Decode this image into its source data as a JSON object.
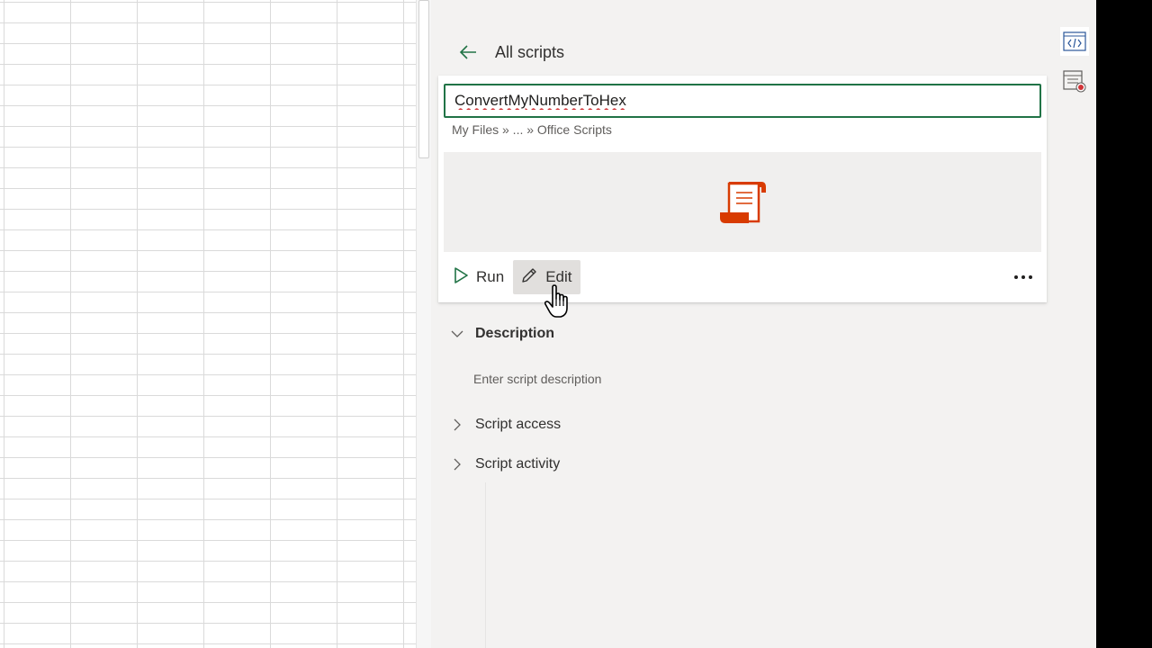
{
  "pane": {
    "back_label": "All scripts",
    "script_name": "ConvertMyNumberToHex",
    "path": "My Files » ... » Office Scripts",
    "actions": {
      "run_label": "Run",
      "edit_label": "Edit"
    },
    "sections": {
      "description_label": "Description",
      "description_placeholder": "Enter script description",
      "access_label": "Script access",
      "activity_label": "Script activity"
    }
  },
  "icons": {
    "back": "arrow-left-icon",
    "script_preview": "script-scroll-icon",
    "run": "play-icon",
    "edit": "pencil-icon",
    "more": "more-horizontal-icon",
    "code_editor": "code-icon",
    "record": "record-actions-icon"
  },
  "colors": {
    "accent": "#217346",
    "script_icon": "#d83b01",
    "spell_error": "#d13438"
  }
}
